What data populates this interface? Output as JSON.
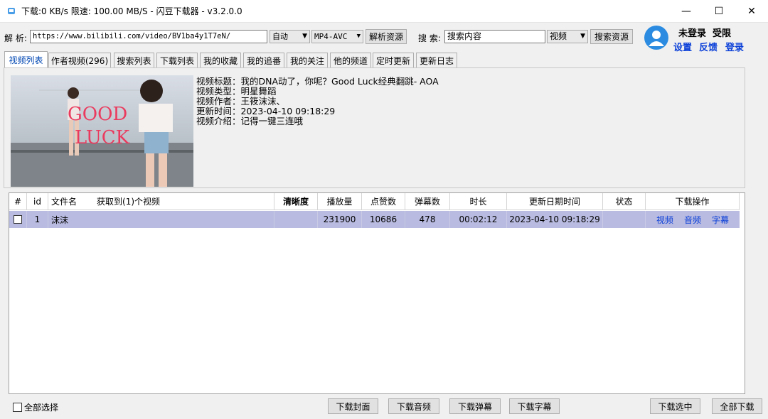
{
  "window": {
    "title": "下载:0 KB/s  限速:  100.00 MB/S  - 闪豆下载器 - v3.2.0.0",
    "minimize": "—",
    "maximize": "☐",
    "close": "✕"
  },
  "toolbar": {
    "parse_label": "解 析:",
    "url_value": "https://www.bilibili.com/video/BV1ba4y1T7eN/",
    "quality_value": "自动",
    "codec_value": "MP4-AVC",
    "parse_button": "解析资源",
    "search_label": "搜 索:",
    "search_value": "搜索内容",
    "search_type_value": "视频",
    "search_button": "搜索资源"
  },
  "user": {
    "status": "未登录",
    "limit": "受限",
    "settings": "设置",
    "feedback": "反馈",
    "login": "登录"
  },
  "tabs": [
    "视频列表",
    "作者视频(296)",
    "搜索列表",
    "下载列表",
    "我的收藏",
    "我的追番",
    "我的关注",
    "他的频道",
    "定时更新",
    "更新日志"
  ],
  "video_info": {
    "title": "视频标题：我的DNA动了，你呢？Good Luck经典翻跳- AOA",
    "type": "视频类型：明星舞蹈",
    "author": "视频作者：王筱沫沫、",
    "updated": "更新时间：2023-04-10 09:18:29",
    "intro": "视频介绍：记得一键三连哦",
    "thumbnail_text_1": "GOOD",
    "thumbnail_text_2": "LUCK"
  },
  "table": {
    "headers": {
      "hash": "#",
      "id": "id",
      "filename": "文件名",
      "count": "获取到(1)个视频",
      "quality": "清晰度",
      "plays": "播放量",
      "likes": "点赞数",
      "danmaku": "弹幕数",
      "duration": "时长",
      "updated": "更新日期时间",
      "status": "状态",
      "actions": "下载操作"
    },
    "rows": [
      {
        "checked": false,
        "id": "1",
        "filename": "沫沫",
        "quality": "",
        "plays": "231900",
        "likes": "10686",
        "danmaku": "478",
        "duration": "00:02:12",
        "updated": "2023-04-10 09:18:29",
        "status": "",
        "action_video": "视频",
        "action_audio": "音频",
        "action_subtitle": "字幕"
      }
    ]
  },
  "footer": {
    "select_all": "全部选择",
    "download_cover": "下载封面",
    "download_audio": "下载音频",
    "download_danmaku": "下载弹幕",
    "download_subtitle": "下载字幕",
    "download_selected": "下载选中",
    "download_all": "全部下载"
  },
  "colors": {
    "row_highlight": "#b9bbe0",
    "link": "#0a3fd8",
    "active_tab_text": "#0047b3",
    "avatar": "#2b8be0"
  }
}
